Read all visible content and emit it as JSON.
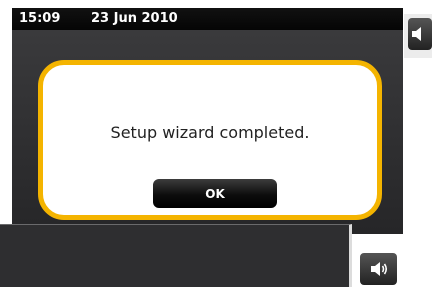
{
  "status_bar": {
    "time": "15:09",
    "date": "23 Jun 2010"
  },
  "dialog": {
    "message": "Setup wizard completed.",
    "ok_label": "OK"
  },
  "icons": {
    "volume": "speaker-volume-icon"
  },
  "colors": {
    "dialog_border": "#f4b400",
    "screen_bg": "#2b2b2d",
    "status_bar": "#0a0a0a"
  }
}
